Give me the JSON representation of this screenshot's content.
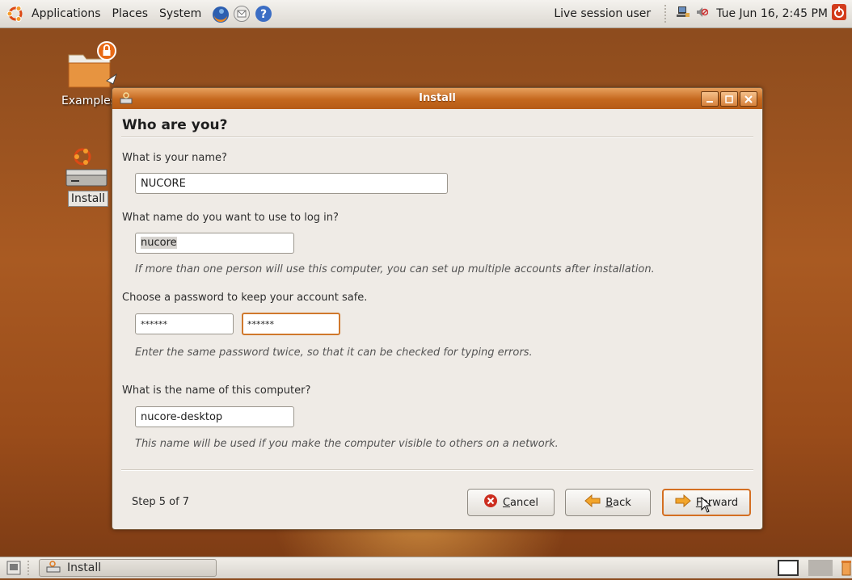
{
  "top_panel": {
    "menus": [
      "Applications",
      "Places",
      "System"
    ],
    "user": "Live session user",
    "clock": "Tue Jun 16,  2:45 PM"
  },
  "desktop": {
    "icons": [
      {
        "label": "Examples"
      },
      {
        "label": "Install"
      }
    ]
  },
  "window": {
    "title": "Install",
    "heading": "Who are you?",
    "name_question": "What is your name?",
    "name_value": "NUCORE",
    "login_question": "What name do you want to use to log in?",
    "login_value": "nucore",
    "login_hint": "If more than one person will use this computer, you can set up multiple accounts after installation.",
    "password_question": "Choose a password to keep your account safe.",
    "password_value": "******",
    "password_confirm_value": "******",
    "password_hint": "Enter the same password twice, so that it can be checked for typing errors.",
    "computer_question": "What is the name of this computer?",
    "computer_value": "nucore-desktop",
    "computer_hint": "This name will be used if you make the computer visible to others on a network.",
    "step": "Step 5 of 7",
    "buttons": {
      "cancel_mnemonic": "C",
      "cancel_rest": "ancel",
      "back_mnemonic": "B",
      "back_rest": "ack",
      "forward_mnemonic": "F",
      "forward_rest": "orward"
    }
  },
  "bottom_panel": {
    "task": "Install"
  },
  "colors": {
    "accent": "#d46f22",
    "titlebar": "#c4671d"
  }
}
